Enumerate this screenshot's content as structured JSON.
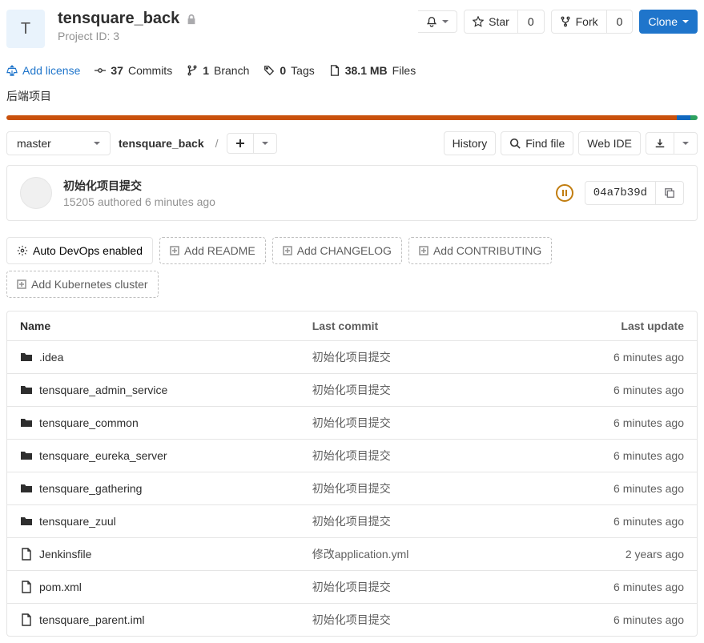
{
  "project": {
    "initial": "T",
    "name": "tensquare_back",
    "id_label": "Project ID: 3",
    "description": "后端项目"
  },
  "header_actions": {
    "star_label": "Star",
    "star_count": "0",
    "fork_label": "Fork",
    "fork_count": "0",
    "clone_label": "Clone"
  },
  "stats": {
    "add_license": "Add license",
    "commits_count": "37",
    "commits_label": "Commits",
    "branches_count": "1",
    "branches_label": "Branch",
    "tags_count": "0",
    "tags_label": "Tags",
    "size": "38.1 MB",
    "size_label": "Files"
  },
  "lang_bar": [
    {
      "color": "#c9510c",
      "width": "97%"
    },
    {
      "color": "#1068bf",
      "width": "2%"
    },
    {
      "color": "#2da160",
      "width": "1%"
    }
  ],
  "tree": {
    "branch": "master",
    "breadcrumb": "tensquare_back",
    "history_label": "History",
    "find_file_label": "Find file",
    "web_ide_label": "Web IDE"
  },
  "commit": {
    "message": "初始化项目提交",
    "author": "15205",
    "authored": "authored",
    "time": "6 minutes ago",
    "sha": "04a7b39d"
  },
  "suggestions": {
    "devops": "Auto DevOps enabled",
    "readme": "Add README",
    "changelog": "Add CHANGELOG",
    "contributing": "Add CONTRIBUTING",
    "kubernetes": "Add Kubernetes cluster"
  },
  "table": {
    "headers": {
      "name": "Name",
      "commit": "Last commit",
      "update": "Last update"
    },
    "rows": [
      {
        "type": "folder",
        "name": ".idea",
        "commit": "初始化项目提交",
        "update": "6 minutes ago"
      },
      {
        "type": "folder",
        "name": "tensquare_admin_service",
        "commit": "初始化项目提交",
        "update": "6 minutes ago"
      },
      {
        "type": "folder",
        "name": "tensquare_common",
        "commit": "初始化项目提交",
        "update": "6 minutes ago"
      },
      {
        "type": "folder",
        "name": "tensquare_eureka_server",
        "commit": "初始化项目提交",
        "update": "6 minutes ago"
      },
      {
        "type": "folder",
        "name": "tensquare_gathering",
        "commit": "初始化项目提交",
        "update": "6 minutes ago"
      },
      {
        "type": "folder",
        "name": "tensquare_zuul",
        "commit": "初始化项目提交",
        "update": "6 minutes ago"
      },
      {
        "type": "file",
        "name": "Jenkinsfile",
        "commit": "修改application.yml",
        "update": "2 years ago"
      },
      {
        "type": "file",
        "name": "pom.xml",
        "commit": "初始化项目提交",
        "update": "6 minutes ago"
      },
      {
        "type": "file",
        "name": "tensquare_parent.iml",
        "commit": "初始化项目提交",
        "update": "6 minutes ago"
      }
    ]
  }
}
